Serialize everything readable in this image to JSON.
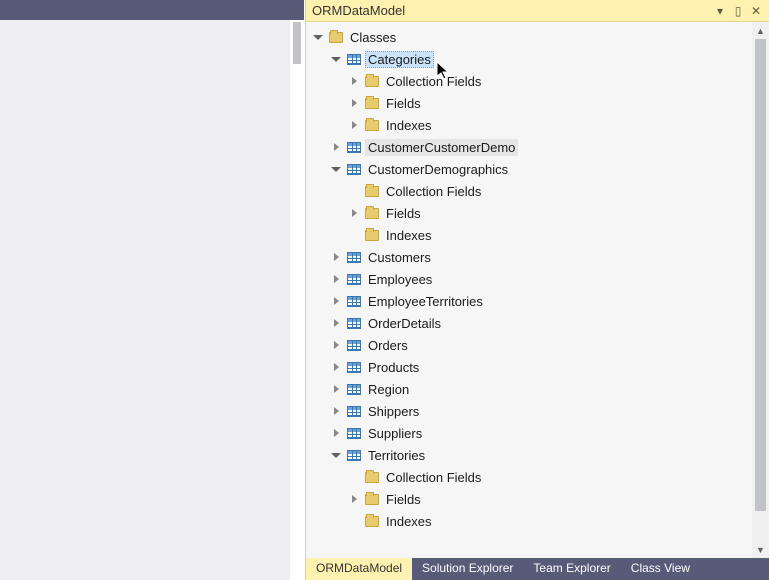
{
  "panel": {
    "title": "ORMDataModel"
  },
  "tree": {
    "root": {
      "label": "Classes"
    },
    "categories": {
      "label": "Categories",
      "children": {
        "cf": "Collection Fields",
        "f": "Fields",
        "ix": "Indexes"
      }
    },
    "ccd": {
      "label": "CustomerCustomerDemo"
    },
    "cdemo": {
      "label": "CustomerDemographics",
      "children": {
        "cf": "Collection Fields",
        "f": "Fields",
        "ix": "Indexes"
      }
    },
    "customers": {
      "label": "Customers"
    },
    "employees": {
      "label": "Employees"
    },
    "empterr": {
      "label": "EmployeeTerritories"
    },
    "orderdetails": {
      "label": "OrderDetails"
    },
    "orders": {
      "label": "Orders"
    },
    "products": {
      "label": "Products"
    },
    "region": {
      "label": "Region"
    },
    "shippers": {
      "label": "Shippers"
    },
    "suppliers": {
      "label": "Suppliers"
    },
    "territories": {
      "label": "Territories",
      "children": {
        "cf": "Collection Fields",
        "f": "Fields",
        "ix": "Indexes"
      }
    }
  },
  "tabs": {
    "orm": "ORMDataModel",
    "sol": "Solution Explorer",
    "team": "Team Explorer",
    "cls": "Class View"
  }
}
